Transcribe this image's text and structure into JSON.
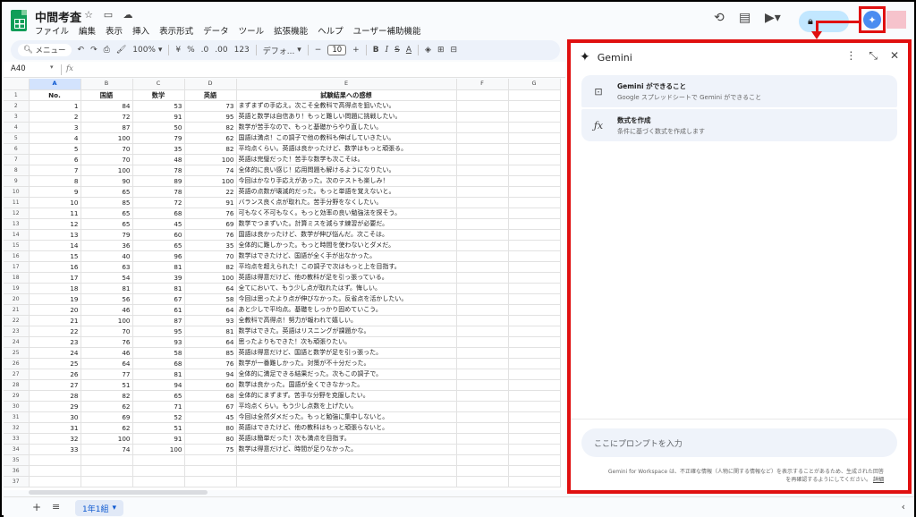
{
  "app": {
    "doc_title": "中間考査",
    "menus": [
      "ファイル",
      "編集",
      "表示",
      "挿入",
      "表示形式",
      "データ",
      "ツール",
      "拡張機能",
      "ヘルプ",
      "ユーザー補助機能"
    ]
  },
  "toolbar": {
    "menu_search": "メニュー",
    "zoom": "100%",
    "currency": "¥",
    "percent": "%",
    "dec_decrease": ".0",
    "dec_increase": ".00",
    "number_format": "123",
    "font": "デフォ...",
    "font_size": "10"
  },
  "formula_bar": {
    "cell_ref": "A40",
    "fx": "fx"
  },
  "grid": {
    "columns": [
      "A",
      "B",
      "C",
      "D",
      "E",
      "F",
      "G"
    ],
    "header": {
      "no": "No.",
      "kokugo": "国語",
      "sugaku": "数学",
      "eigo": "英語",
      "comment": "試験結果への感想"
    },
    "rows": [
      [
        1,
        84,
        53,
        73,
        "まずまずの手応え。次こそ全教科で高得点を狙いたい。"
      ],
      [
        2,
        72,
        91,
        95,
        "英語と数学は自信あり！もっと難しい問題に挑戦したい。"
      ],
      [
        3,
        87,
        50,
        82,
        "数学が苦手なので、もっと基礎からやり直したい。"
      ],
      [
        4,
        100,
        79,
        62,
        "国語は満点！この調子で他の教科も伸ばしていきたい。"
      ],
      [
        5,
        70,
        35,
        82,
        "平均点くらい。英語は良かったけど、数学はもっと頑張る。"
      ],
      [
        6,
        70,
        48,
        100,
        "英語は完璧だった！苦手な数学も次こそは。"
      ],
      [
        7,
        100,
        78,
        74,
        "全体的に良い感じ！応用問題も解けるようになりたい。"
      ],
      [
        8,
        90,
        89,
        100,
        "今回はかなり手応えがあった。次のテストも楽しみ！"
      ],
      [
        9,
        65,
        78,
        22,
        "英語の点数が壊滅的だった。もっと単語を覚えないと。"
      ],
      [
        10,
        85,
        72,
        91,
        "バランス良く点が取れた。苦手分野をなくしたい。"
      ],
      [
        11,
        65,
        68,
        76,
        "可もなく不可もなく。もっと効率の良い勉強法を探そう。"
      ],
      [
        12,
        65,
        45,
        69,
        "数学でつまずいた。計算ミスを減らす練習が必要だ。"
      ],
      [
        13,
        79,
        60,
        76,
        "国語は良かったけど、数学が伸び悩んだ。次こそは。"
      ],
      [
        14,
        36,
        65,
        35,
        "全体的に難しかった。もっと時間を使わないとダメだ。"
      ],
      [
        15,
        40,
        96,
        70,
        "数学はできたけど、国語が全く手が出なかった。"
      ],
      [
        16,
        63,
        81,
        82,
        "平均点を超えられた！この調子で次はもっと上を目指す。"
      ],
      [
        17,
        54,
        39,
        100,
        "英語は得意だけど、他の教科が足を引っ張っている。"
      ],
      [
        18,
        81,
        81,
        64,
        "全てにおいて、もう少し点が取れたはず。悔しい。"
      ],
      [
        19,
        56,
        67,
        58,
        "今回は思ったより点が伸びなかった。反省点を活かしたい。"
      ],
      [
        20,
        46,
        61,
        64,
        "あと少しで平均点。基礎をしっかり固めていこう。"
      ],
      [
        21,
        100,
        87,
        93,
        "全教科で高得点！努力が報われて嬉しい。"
      ],
      [
        22,
        70,
        95,
        81,
        "数学はできた。英語はリスニングが課題かな。"
      ],
      [
        23,
        76,
        93,
        64,
        "思ったよりもできた！次も頑張りたい。"
      ],
      [
        24,
        46,
        58,
        85,
        "英語は得意だけど、国語と数学が足を引っ張った。"
      ],
      [
        25,
        64,
        68,
        76,
        "数学が一番難しかった。対策が不十分だった。"
      ],
      [
        26,
        77,
        81,
        94,
        "全体的に満足できる結果だった。次もこの調子で。"
      ],
      [
        27,
        51,
        94,
        60,
        "数学は良かった。国語が全くできなかった。"
      ],
      [
        28,
        82,
        65,
        68,
        "全体的にまずまず。苦手な分野を克服したい。"
      ],
      [
        29,
        62,
        71,
        67,
        "平均点くらい。もう少し点数を上げたい。"
      ],
      [
        30,
        69,
        52,
        45,
        "今回は全然ダメだった。もっと勉強に集中しないと。"
      ],
      [
        31,
        62,
        51,
        80,
        "英語はできたけど、他の教科はもっと頑張らないと。"
      ],
      [
        32,
        100,
        91,
        80,
        "英語は簡単だった！次も満点を目指す。"
      ],
      [
        33,
        74,
        100,
        75,
        "数学は得意だけど、時間が足りなかった。"
      ]
    ],
    "total_row_numbers": 37
  },
  "sheets": {
    "active": "1年1組"
  },
  "gemini": {
    "title": "Gemini",
    "card1_title": "Gemini ができること",
    "card1_sub": "Google スプレッドシートで Gemini ができること",
    "card2_title": "数式を作成",
    "card2_sub": "条件に基づく数式を作成します",
    "input_placeholder": "ここにプロンプトを入力",
    "disclaimer": "Gemini for Workspace は、不正確な情報（人物に関する情報など）を表示することがあるため、生成された回答を再確認するようにしてください。",
    "disclaimer_link": "詳細"
  },
  "colors": {
    "highlight_red": "#e01010",
    "gemini_blue": "#4a8cf0",
    "share_bg": "#c2e7ff",
    "sheets_green": "#0f9d58"
  }
}
